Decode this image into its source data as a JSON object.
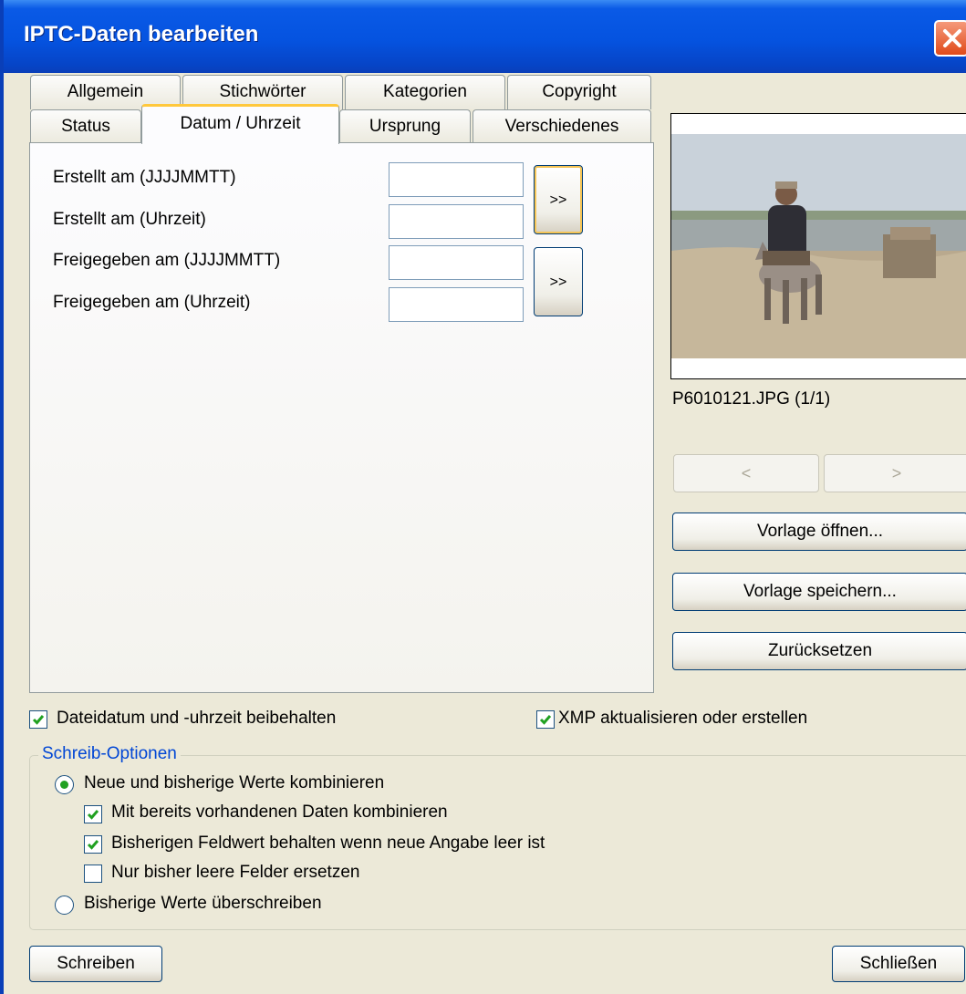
{
  "window": {
    "title": "IPTC-Daten bearbeiten",
    "close_label": "close"
  },
  "tabs": {
    "row1": [
      "Allgemein",
      "Stichwörter",
      "Kategorien",
      "Copyright"
    ],
    "row2": [
      "Status",
      "Datum / Uhrzeit",
      "Ursprung",
      "Verschiedenes"
    ],
    "active": "Datum / Uhrzeit"
  },
  "date_tab": {
    "created_date_label": "Erstellt am (JJJJMMTT)",
    "created_time_label": "Erstellt am (Uhrzeit)",
    "released_date_label": "Freigegeben am (JJJJMMTT)",
    "released_time_label": "Freigegeben am (Uhrzeit)",
    "created_date_value": "",
    "created_time_value": "",
    "released_date_value": "",
    "released_time_value": "",
    "fill_button_label": ">>"
  },
  "preview": {
    "filename": "P6010121.JPG (1/1)",
    "prev_label": "<",
    "next_label": ">"
  },
  "side_buttons": {
    "open_template": "Vorlage öffnen...",
    "save_template": "Vorlage speichern...",
    "reset": "Zurücksetzen"
  },
  "options": {
    "keep_file_date": {
      "label": "Dateidatum und -uhrzeit beibehalten",
      "checked": true
    },
    "update_xmp": {
      "label": "XMP aktualisieren oder erstellen",
      "checked": true
    }
  },
  "write_options": {
    "title": "Schreib-Optionen",
    "combine_radio": {
      "label": "Neue und bisherige Werte kombinieren",
      "selected": true
    },
    "combine_existing": {
      "label": "Mit bereits vorhandenen Daten kombinieren",
      "checked": true
    },
    "keep_value_if_empty": {
      "label": "Bisherigen Feldwert behalten wenn neue Angabe leer ist",
      "checked": true
    },
    "replace_empty_only": {
      "label": "Nur bisher leere Felder ersetzen",
      "checked": false
    },
    "overwrite_radio": {
      "label": "Bisherige Werte überschreiben",
      "selected": false
    }
  },
  "footer": {
    "write_button": "Schreiben",
    "close_button": "Schließen"
  },
  "colors": {
    "title_bar": "#0553e0",
    "group_title": "#0046d5",
    "check_green": "#21a121",
    "tab_highlight": "#ffc83c"
  }
}
